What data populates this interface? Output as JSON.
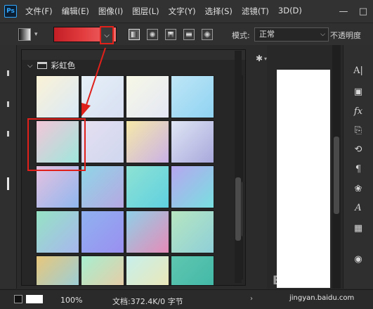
{
  "app": {
    "logo": "Ps"
  },
  "menus": [
    "文件(F)",
    "编辑(E)",
    "图像(I)",
    "图层(L)",
    "文字(Y)",
    "选择(S)",
    "滤镜(T)",
    "3D(D)"
  ],
  "window_controls": [
    "—",
    "□"
  ],
  "options": {
    "mode_label": "模式:",
    "mode_value": "正常",
    "opacity_label": "不透明度"
  },
  "gradient_panel": {
    "folder_name": "彩虹色",
    "swatches": [
      [
        "#fbf2d6",
        "#d9e9f7"
      ],
      [
        "#e6f0f7",
        "#d7dff2"
      ],
      [
        "#f7f8e6",
        "#e4e7f5"
      ],
      [
        "#bfe6f6",
        "#8fd3f2"
      ],
      [
        "#f3c6d8",
        "#9ee7dc"
      ],
      [
        "#e6dff0",
        "#cfd7ef"
      ],
      [
        "#f7e9a8",
        "#c9b1e6"
      ],
      [
        "#dfe6f4",
        "#a9a8dc"
      ],
      [
        "#e6c1df",
        "#8fb7ef"
      ],
      [
        "#8fd6e7",
        "#b7a7e2"
      ],
      [
        "#8ee2d3",
        "#5fd0e0"
      ],
      [
        "#b7a6f0",
        "#78e0e0"
      ],
      [
        "#96e3c4",
        "#a7b7ee"
      ],
      [
        "#8fb2ef",
        "#9a8ff0"
      ],
      [
        "#8fd0e8",
        "#e68bb8"
      ],
      [
        "#b7e6c0",
        "#8ecfd8"
      ],
      [
        "#e8c77b",
        "#8fcfe6"
      ],
      [
        "#a7efd0",
        "#f0c7a0"
      ],
      [
        "#c7f0ec",
        "#f0e6b0"
      ],
      [
        "#5fc7b0",
        "#3fb6a6"
      ]
    ]
  },
  "status": {
    "zoom": "100%",
    "doc_info": "文档:372.4K/0 字节"
  },
  "watermark": {
    "text": "Bai 经验",
    "url": "jingyan.baidu.com"
  },
  "colors": {
    "highlight": "#e0201a",
    "accent": "#31a8ff"
  }
}
